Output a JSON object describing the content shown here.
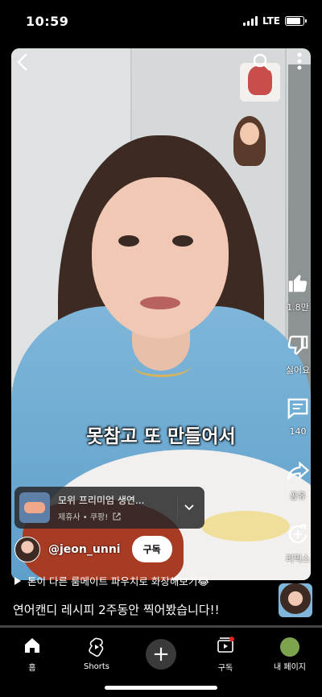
{
  "status_bar": {
    "time": "10:59",
    "network": "LTE",
    "battery_level": 0.85
  },
  "video": {
    "subtitle": "못참고 또 만들어서"
  },
  "actions": {
    "like_count": "1.8만",
    "dislike_label": "싫어요",
    "comment_count": "140",
    "share_label": "공유",
    "remix_label": "리믹스"
  },
  "product": {
    "title": "모위 프리미엄 생연...",
    "subtitle": "제휴사 • 쿠팡!"
  },
  "channel": {
    "name": "@jeon_unni",
    "subscribe_label": "구독"
  },
  "music": {
    "text": "톤이 다른 룸메이트 파우치로 화장해보기😂"
  },
  "caption": "연어캔디 레시피 2주동안 찍어봤습니다!!",
  "progress": 0.0,
  "nav": {
    "home_label": "홈",
    "shorts_label": "Shorts",
    "subscriptions_label": "구독",
    "library_label": "내 페이지"
  },
  "colors": {
    "accent": "#e62117",
    "subscribe_bg": "#ffffff"
  }
}
